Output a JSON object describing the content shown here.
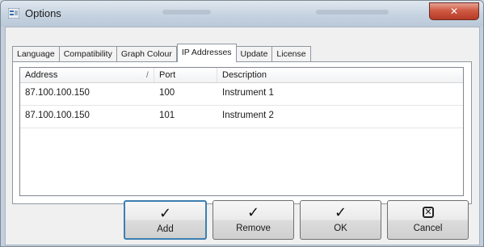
{
  "window": {
    "title": "Options",
    "close_glyph": "✕"
  },
  "tabs": [
    {
      "label": "Language",
      "active": false
    },
    {
      "label": "Compatibility",
      "active": false
    },
    {
      "label": "Graph Colour",
      "active": false
    },
    {
      "label": "IP Addresses",
      "active": true
    },
    {
      "label": "Update",
      "active": false
    },
    {
      "label": "License",
      "active": false
    }
  ],
  "table": {
    "columns": [
      "Address",
      "Port",
      "Description"
    ],
    "sort_indicator": "/",
    "rows": [
      {
        "address": "87.100.100.150",
        "port": "100",
        "description": "Instrument 1"
      },
      {
        "address": "87.100.100.150",
        "port": "101",
        "description": "Instrument 2"
      }
    ]
  },
  "buttons": {
    "add": {
      "label": "Add",
      "icon": "check-icon",
      "glyph": "✓"
    },
    "remove": {
      "label": "Remove",
      "icon": "check-icon",
      "glyph": "✓"
    },
    "ok": {
      "label": "OK",
      "icon": "check-icon",
      "glyph": "✓"
    },
    "cancel": {
      "label": "Cancel",
      "icon": "cancel-box-icon",
      "glyph": "✕"
    }
  },
  "colors": {
    "titlebar": "#c6d3e1",
    "close_button": "#c9503b",
    "default_button_border": "#3c7fb1"
  }
}
